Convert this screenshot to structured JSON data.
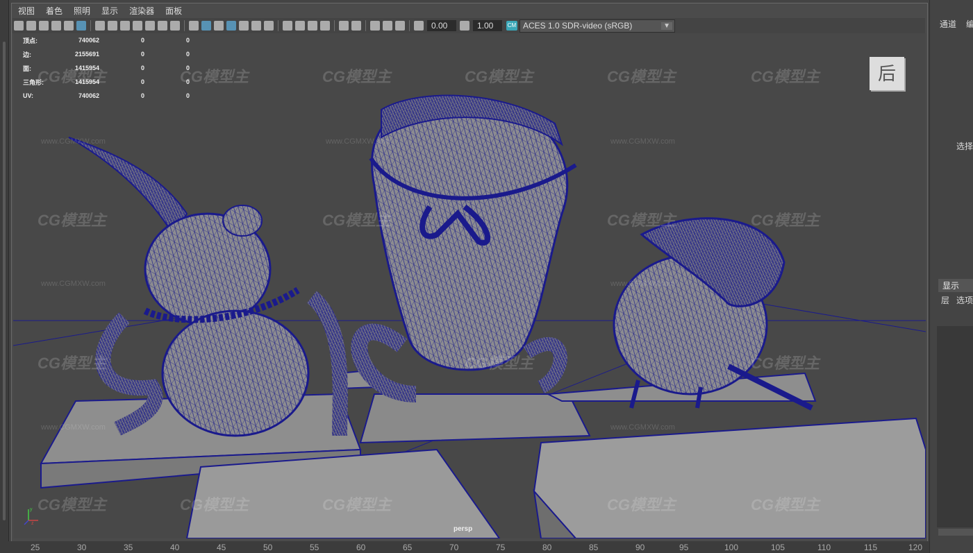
{
  "menu": [
    "视图",
    "着色",
    "照明",
    "显示",
    "渲染器",
    "面板"
  ],
  "toolbar": {
    "exposure": "0.00",
    "gamma": "1.00",
    "color_space": "ACES 1.0 SDR-video (sRGB)",
    "cs_icon": "CM"
  },
  "stats": [
    {
      "label": "顶点:",
      "value": "740062",
      "c1": "0",
      "c2": "0"
    },
    {
      "label": "边:",
      "value": "2155691",
      "c1": "0",
      "c2": "0"
    },
    {
      "label": "面:",
      "value": "1415954",
      "c1": "0",
      "c2": "0"
    },
    {
      "label": "三角形:",
      "value": "1415954",
      "c1": "0",
      "c2": "0"
    },
    {
      "label": "UV:",
      "value": "740062",
      "c1": "0",
      "c2": "0"
    }
  ],
  "camera_label": "persp",
  "viewcube_label": "后",
  "axis": {
    "y": "y",
    "z": "z"
  },
  "watermark": {
    "logo": "CG模型主",
    "url": "www.CGMXW.com"
  },
  "right_panel": {
    "tabs": [
      "通道",
      "编"
    ],
    "select_label": "选择",
    "display_tab": "显示",
    "layer_items": [
      "层",
      "选项"
    ]
  },
  "ruler": [
    "25",
    "30",
    "35",
    "40",
    "45",
    "50",
    "55",
    "60",
    "65",
    "70",
    "75",
    "80",
    "85",
    "90",
    "95",
    "100",
    "105",
    "110",
    "115",
    "120"
  ],
  "colors": {
    "wire": "#1a1a8c",
    "shaded": "#8a8a8a",
    "viewport_bg": "#484848",
    "accent": "#5aa0c8"
  }
}
